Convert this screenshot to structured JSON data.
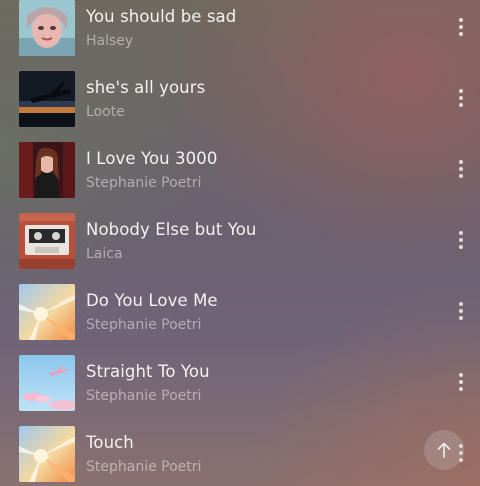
{
  "tracks": [
    {
      "title": "You should be sad",
      "artist": "Halsey",
      "art_icon": "album-art-portrait-icon"
    },
    {
      "title": "she's all yours",
      "artist": "Loote",
      "art_icon": "album-art-airplane-icon"
    },
    {
      "title": "I Love You 3000",
      "artist": "Stephanie Poetri",
      "art_icon": "album-art-portrait-icon"
    },
    {
      "title": "Nobody Else but You",
      "artist": "Laica",
      "art_icon": "album-art-cassette-icon"
    },
    {
      "title": "Do You Love Me",
      "artist": "Stephanie Poetri",
      "art_icon": "album-art-sunburst-icon"
    },
    {
      "title": "Straight To You",
      "artist": "Stephanie Poetri",
      "art_icon": "album-art-sky-plane-icon"
    },
    {
      "title": "Touch",
      "artist": "Stephanie Poetri",
      "art_icon": "album-art-sunburst-icon"
    }
  ],
  "more_icon": "more-vertical-icon",
  "scroll_top_icon": "arrow-up-icon"
}
